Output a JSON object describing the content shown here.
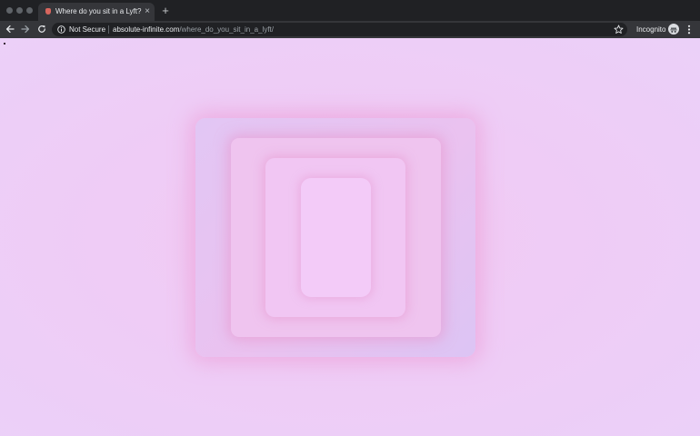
{
  "window": {
    "controls": [
      "close",
      "minimize",
      "zoom"
    ]
  },
  "tab": {
    "title": "Where do you sit in a Lyft?",
    "close_glyph": "×",
    "favicon": "site-favicon-icon"
  },
  "new_tab_glyph": "+",
  "toolbar": {
    "back_icon": "arrow-left-icon",
    "forward_icon": "arrow-right-icon",
    "reload_icon": "reload-icon",
    "security_label": "Not Secure",
    "url_host": "absolute-infinite.com",
    "url_path": "/where_do_you_sit_in_a_lyft/",
    "bookmark_icon": "star-icon",
    "incognito_label": "Incognito",
    "menu_icon": "kebab-menu-icon"
  },
  "colors": {
    "chrome_dark": "#202124",
    "toolbar": "#35363a",
    "page_background": "#efccf6",
    "glow_pink": "#eb96d2"
  },
  "content": {
    "nested_rectangles": 4
  }
}
